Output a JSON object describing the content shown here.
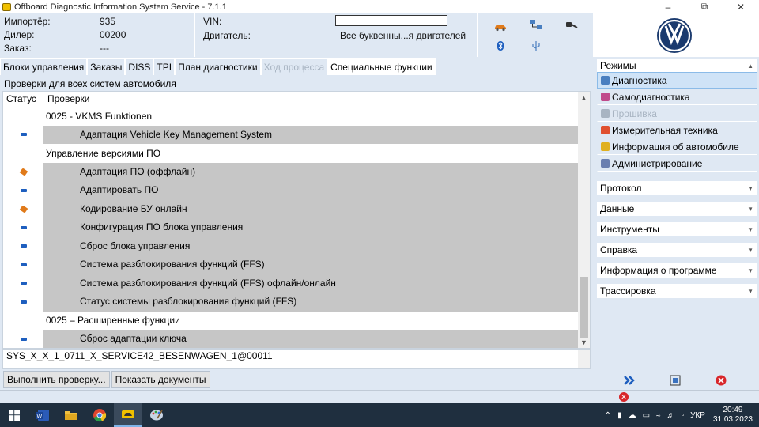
{
  "window": {
    "title": "Offboard Diagnostic Information System Service - 7.1.1"
  },
  "header": {
    "importer_label": "Импортёр:",
    "importer_value": "935",
    "dealer_label": "Дилер:",
    "dealer_value": "00200",
    "order_label": "Заказ:",
    "order_value": "---",
    "vin_label": "VIN:",
    "vin_value": "",
    "engine_label": "Двигатель:",
    "engine_value": "Все буквенны...я двигателей"
  },
  "tabs": [
    {
      "label": "Блоки управления",
      "state": "normal"
    },
    {
      "label": "Заказы",
      "state": "normal"
    },
    {
      "label": "DISS",
      "state": "normal"
    },
    {
      "label": "TPI",
      "state": "normal"
    },
    {
      "label": "План диагностики",
      "state": "normal"
    },
    {
      "label": "Ход процесса",
      "state": "disabled"
    },
    {
      "label": "Специальные функции",
      "state": "active"
    }
  ],
  "subheader": "Проверки для всех систем автомобиля",
  "columns": {
    "status": "Статус",
    "checks": "Проверки"
  },
  "rows": [
    {
      "kind": "group",
      "text": "0025 - VKMS Funktionen",
      "status": ""
    },
    {
      "kind": "item",
      "text": "Адаптация Vehicle Key Management System",
      "status": "blue"
    },
    {
      "kind": "group",
      "text": "Управление версиями ПО",
      "status": ""
    },
    {
      "kind": "item",
      "text": "Адаптация ПО (оффлайн)",
      "status": "orange"
    },
    {
      "kind": "item",
      "text": "Адаптировать ПО",
      "status": "blue"
    },
    {
      "kind": "item",
      "text": "Кодирование БУ онлайн",
      "status": "orange"
    },
    {
      "kind": "item",
      "text": "Конфигурация ПО блока управления",
      "status": "blue"
    },
    {
      "kind": "item",
      "text": "Сброс блока управления",
      "status": "blue"
    },
    {
      "kind": "item",
      "text": "Система разблокирования функций (FFS)",
      "status": "blue"
    },
    {
      "kind": "item",
      "text": "Система разблокирования функций (FFS) офлайн/онлайн",
      "status": "blue"
    },
    {
      "kind": "item",
      "text": "Статус системы разблокирования функций (FFS)",
      "status": "blue"
    },
    {
      "kind": "group",
      "text": "0025 – Расширенные функции",
      "status": ""
    },
    {
      "kind": "item",
      "text": "Сброс адаптации ключа",
      "status": "blue"
    }
  ],
  "path_text": "SYS_X_X_1_0711_X_SERVICE42_BESENWAGEN_1@00011",
  "buttons": {
    "run_check": "Выполнить проверку...",
    "show_docs": "Показать документы"
  },
  "right_panel": {
    "modes_title": "Режимы",
    "modes": [
      {
        "label": "Диагностика",
        "state": "selected",
        "icon": "stethoscope-icon"
      },
      {
        "label": "Самодиагностика",
        "state": "normal",
        "icon": "car-check-icon"
      },
      {
        "label": "Прошивка",
        "state": "disabled",
        "icon": "flash-icon"
      },
      {
        "label": "Измерительная техника",
        "state": "normal",
        "icon": "gauge-icon"
      },
      {
        "label": "Информация об автомобиле",
        "state": "normal",
        "icon": "info-icon"
      },
      {
        "label": "Администрирование",
        "state": "normal",
        "icon": "admin-icon"
      }
    ],
    "sections": [
      "Протокол",
      "Данные",
      "Инструменты",
      "Справка",
      "Информация о программе",
      "Трассировка"
    ]
  },
  "taskbar": {
    "lang": "УКР",
    "time": "20:49",
    "date": "31.03.2023"
  },
  "colors": {
    "panel_bg": "#dfe8f3",
    "item_bg": "#c6c6c6",
    "status_blue": "#1e5fbf",
    "status_orange": "#e07a1a",
    "error_red": "#d8262a"
  }
}
